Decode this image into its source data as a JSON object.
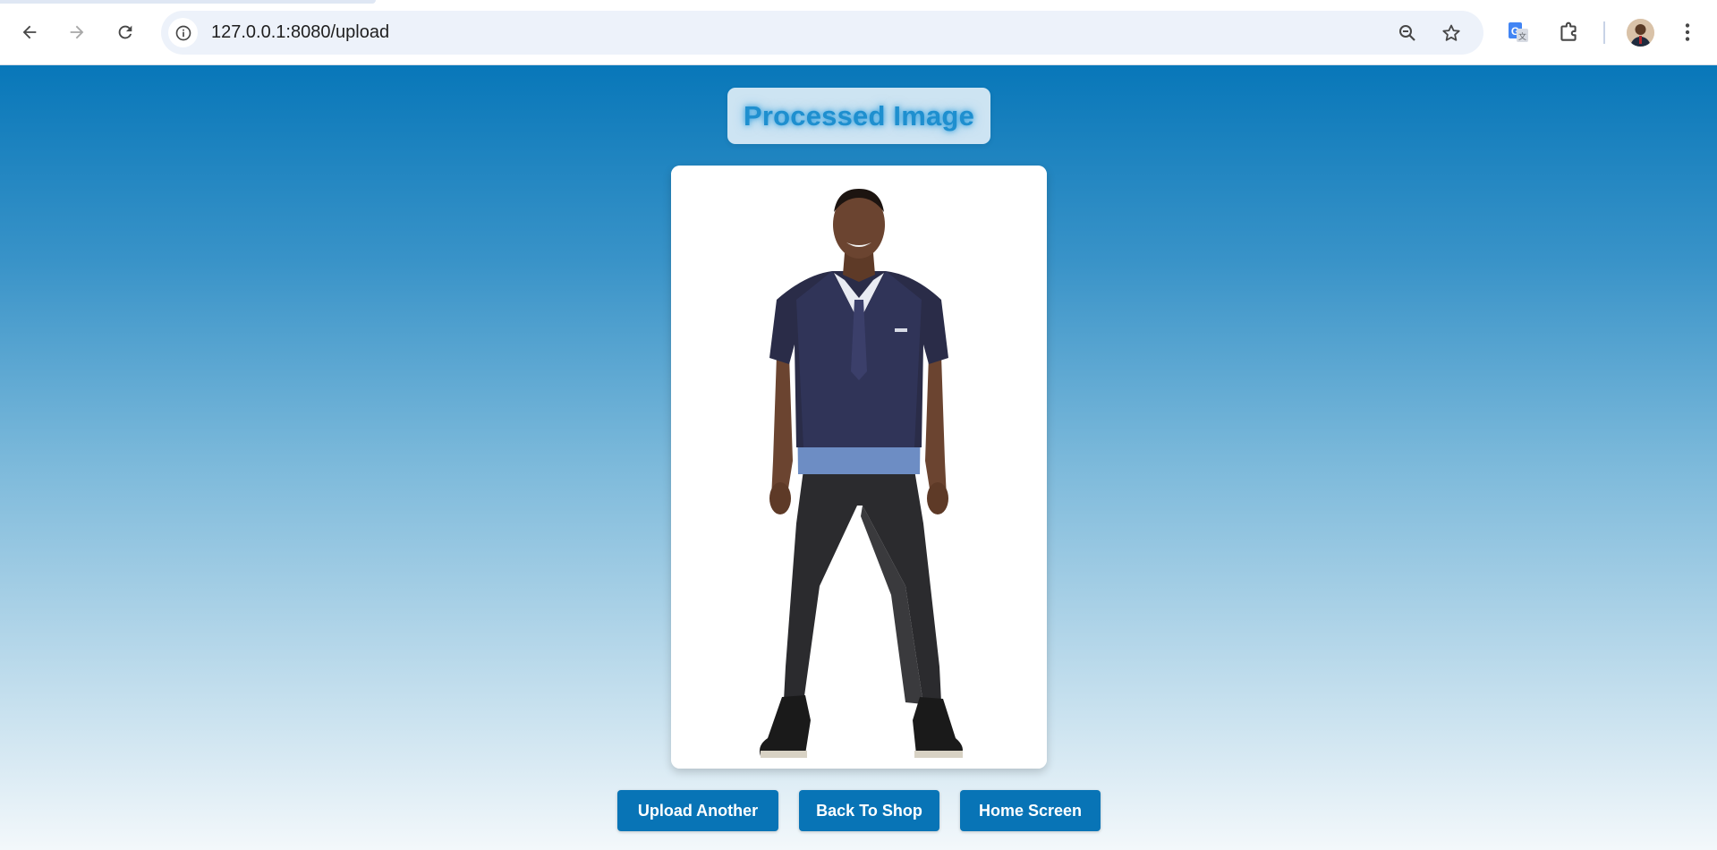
{
  "browser": {
    "url": "127.0.0.1:8080/upload",
    "icons": {
      "back": "arrow-left-icon",
      "forward": "arrow-right-icon",
      "reload": "reload-icon",
      "site_info": "info-icon",
      "zoom": "zoom-out-icon",
      "bookmark": "star-icon",
      "translate": "google-translate-icon",
      "extensions": "puzzle-icon",
      "profile": "avatar",
      "menu": "kebab-menu-icon"
    }
  },
  "page": {
    "title": "Processed Image",
    "image_alt": "Man wearing a printed suit t-shirt and black jeans",
    "buttons": {
      "upload_another": "Upload Another",
      "back_to_shop": "Back To Shop",
      "home_screen": "Home Screen"
    },
    "colors": {
      "gradient_top": "#0877b9",
      "gradient_bottom": "#f3f8fb",
      "button_bg": "#0874b6",
      "title_text": "#1e8fcf"
    }
  }
}
